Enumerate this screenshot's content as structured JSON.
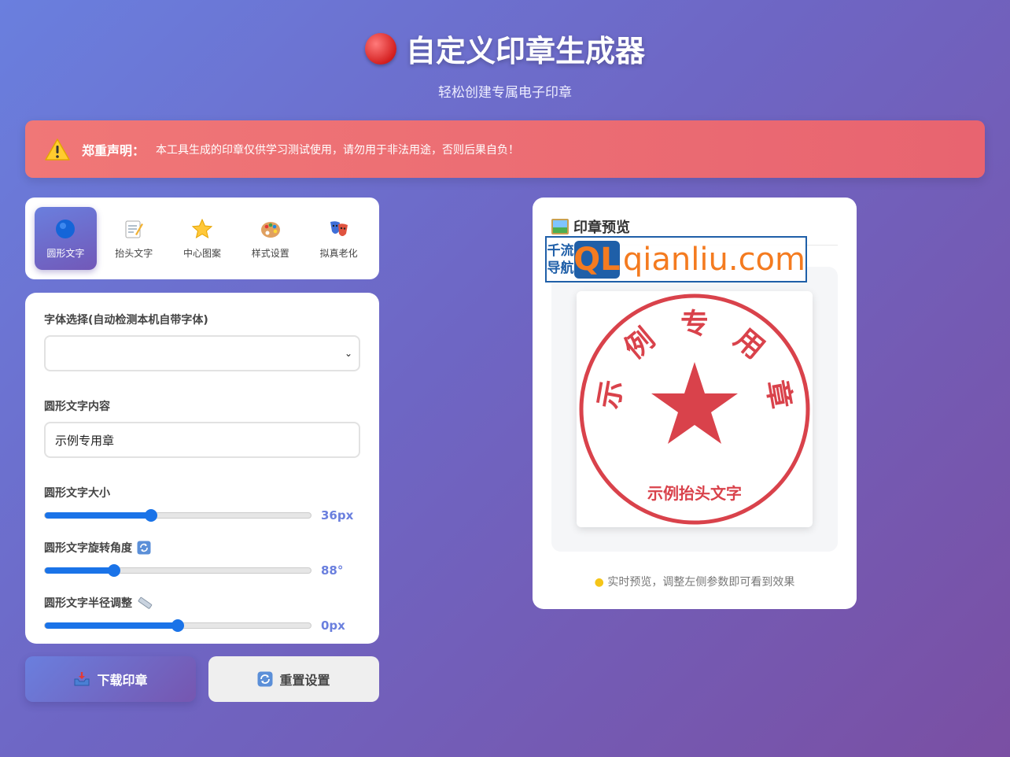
{
  "header": {
    "title": "自定义印章生成器",
    "subtitle": "轻松创建专属电子印章"
  },
  "warning": {
    "title": "郑重声明：",
    "text": "本工具生成的印章仅供学习测试使用，请勿用于非法用途，否则后果自负！"
  },
  "tabs": [
    {
      "label": "圆形文字",
      "icon": "blue-circle-icon",
      "active": true
    },
    {
      "label": "抬头文字",
      "icon": "memo-icon",
      "active": false
    },
    {
      "label": "中心图案",
      "icon": "star-icon",
      "active": false
    },
    {
      "label": "样式设置",
      "icon": "palette-icon",
      "active": false
    },
    {
      "label": "拟真老化",
      "icon": "masks-icon",
      "active": false
    }
  ],
  "panel": {
    "font_label": "字体选择(自动检测本机自带字体)",
    "font_value": "",
    "text_label": "圆形文字内容",
    "text_value": "示例专用章",
    "size_label": "圆形文字大小",
    "size_value": "36px",
    "size_fraction": 0.4,
    "rotate_label": "圆形文字旋转角度",
    "rotate_value": "88°",
    "rotate_fraction": 0.26,
    "radius_label": "圆形文字半径调整",
    "radius_value": "0px",
    "radius_fraction": 0.5
  },
  "buttons": {
    "download": "下载印章",
    "reset": "重置设置"
  },
  "preview": {
    "title": "印章预览",
    "stamp_chars": [
      "示",
      "例",
      "专",
      "用",
      "章"
    ],
    "stamp_bottom_text": "示例抬头文字",
    "stamp_color": "#d9424b",
    "hint": "实时预览，调整左侧参数即可看到效果"
  },
  "watermark": {
    "cn_line1": "千流",
    "cn_line2": "导航",
    "logo": "QL",
    "url": "qianliu.com"
  },
  "colors": {
    "accent": "#6a7fde",
    "slider": "#1a73e8",
    "warning": "#ec6a73"
  }
}
